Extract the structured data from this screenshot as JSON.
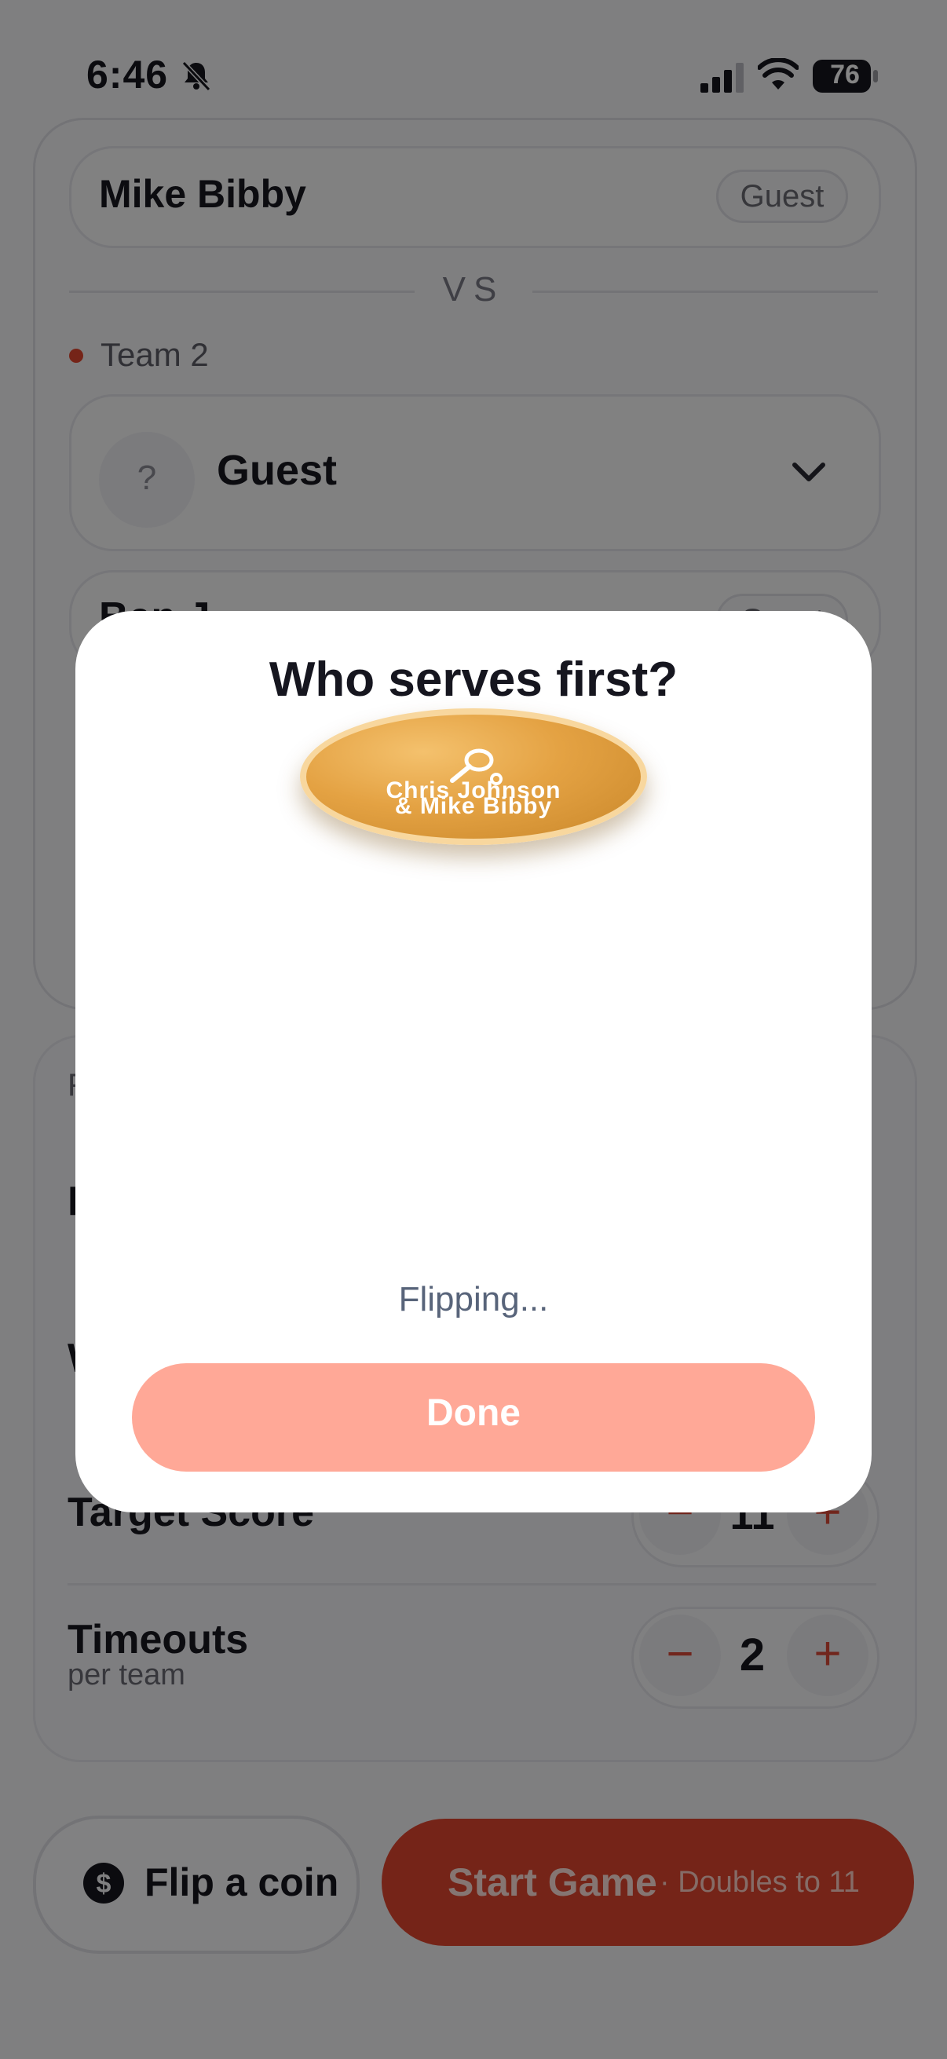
{
  "status_bar": {
    "time": "6:46",
    "battery": "76"
  },
  "team1": {
    "player_name": "Mike Bibby",
    "player_tag": "Guest"
  },
  "vs_label": "VS",
  "team2": {
    "label": "Team 2",
    "select_placeholder_icon": "?",
    "select_value": "Guest",
    "partial_player": "Ben J",
    "partial_tag": "Guest"
  },
  "settings": {
    "partial_label_a": "F",
    "partial_label_b": "W",
    "target_score": {
      "label": "Target Score",
      "value": "11"
    },
    "timeouts": {
      "label": "Timeouts",
      "sublabel": "per team",
      "value": "2",
      "minus": "−",
      "plus": "+"
    }
  },
  "footer": {
    "flip_label": "Flip a coin",
    "start_label": "Start Game",
    "start_detail": "· Doubles to 11"
  },
  "modal": {
    "title": "Who serves first?",
    "coin_line1": "Chris Johnson",
    "coin_line2": "& Mike Bibby",
    "status": "Flipping...",
    "done_label": "Done"
  },
  "colors": {
    "accent": "#e0452e",
    "done_button": "#ffa897",
    "coin_gold": "#e4a243"
  },
  "icons": [
    "bell-muted-icon",
    "signal-icon",
    "wifi-icon",
    "battery-icon",
    "chevron-down-icon",
    "dollar-icon",
    "paddle-icon"
  ]
}
